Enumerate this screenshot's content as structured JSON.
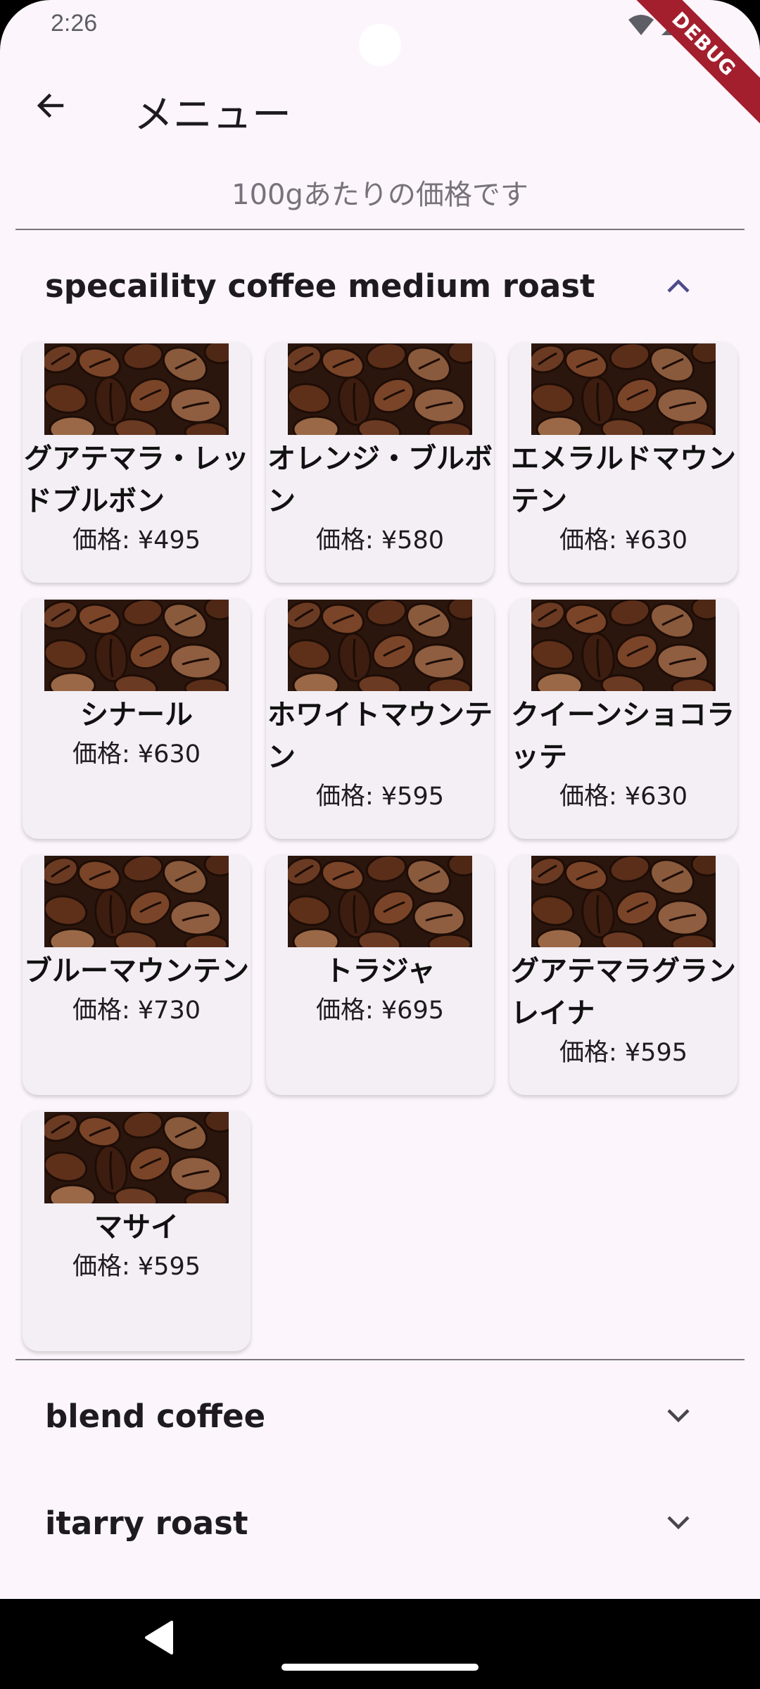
{
  "status_bar": {
    "time": "2:26",
    "debug_label": "DEBUG"
  },
  "app_bar": {
    "title": "メニュー",
    "back_icon": "arrow-back-icon"
  },
  "subtitle": "100gあたりの価格です",
  "sections": [
    {
      "title": "specaility coffee medium roast",
      "expanded": true,
      "chevron_icon": "chevron-up-icon",
      "products": [
        {
          "name": "グアテマラ・レッドブルボン",
          "price": "価格: ¥495"
        },
        {
          "name": "オレンジ・ブルボン",
          "price": "価格: ¥580"
        },
        {
          "name": "エメラルドマウンテン",
          "price": "価格: ¥630"
        },
        {
          "name": "シナール",
          "price": "価格: ¥630"
        },
        {
          "name": "ホワイトマウンテン",
          "price": "価格: ¥595"
        },
        {
          "name": "クイーンショコラッテ",
          "price": "価格: ¥630"
        },
        {
          "name": "ブルーマウンテン",
          "price": "価格: ¥730"
        },
        {
          "name": "トラジャ",
          "price": "価格: ¥695"
        },
        {
          "name": "グアテマラグランレイナ",
          "price": "価格: ¥595"
        },
        {
          "name": "マサイ",
          "price": "価格: ¥595"
        }
      ]
    },
    {
      "title": "blend coffee",
      "expanded": false,
      "chevron_icon": "chevron-down-icon"
    },
    {
      "title": "itarry roast",
      "expanded": false,
      "chevron_icon": "chevron-down-icon"
    }
  ],
  "colors": {
    "background": "#fcf6fc",
    "card": "#f4eff5",
    "chevron_expanded": "#4f4a8c",
    "debug_ribbon": "#a31f2e"
  }
}
